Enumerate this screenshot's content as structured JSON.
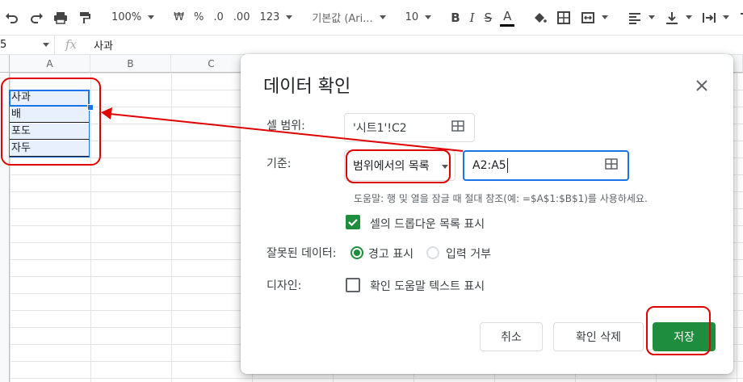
{
  "toolbar": {
    "zoom": "100%",
    "currency": "₩",
    "percent": "%",
    "dec_decrease": ".0",
    "dec_increase": ".00",
    "format_more": "123",
    "font_family": "기본값 (Ari...",
    "font_size": "10",
    "bold": "B",
    "italic": "I",
    "strike": "S",
    "text_color": "A"
  },
  "formula_bar": {
    "name_box": "5",
    "fx": "fx",
    "value": "사과"
  },
  "columns": [
    "A",
    "B",
    "C"
  ],
  "cells": [
    "사과",
    "배",
    "포도",
    "자두"
  ],
  "dialog": {
    "title": "데이터 확인",
    "cell_range_label": "셀 범위:",
    "cell_range_value": "'시트1'!C2",
    "criteria_label": "기준:",
    "criteria_type": "범위에서의 목록",
    "criteria_range": "A2:A5",
    "helper_text": "도움말: 행 및 열을 잠글 때 절대 참조(예: =$A$1:$B$1)를 사용하세요.",
    "show_dropdown_label": "셀의 드롭다운 목록 표시",
    "show_dropdown_checked": true,
    "invalid_label": "잘못된 데이터:",
    "invalid_opt_warn": "경고 표시",
    "invalid_opt_reject": "입력 거부",
    "invalid_selected": "경고 표시",
    "appearance_label": "디자인:",
    "help_text_checkbox": "확인 도움말 텍스트 표시",
    "help_text_checked": false,
    "btn_cancel": "취소",
    "btn_remove": "확인 삭제",
    "btn_save": "저장"
  },
  "colors": {
    "accent_green": "#1e8e3e",
    "accent_blue": "#1a73e8",
    "annotation_red": "#e00000"
  }
}
